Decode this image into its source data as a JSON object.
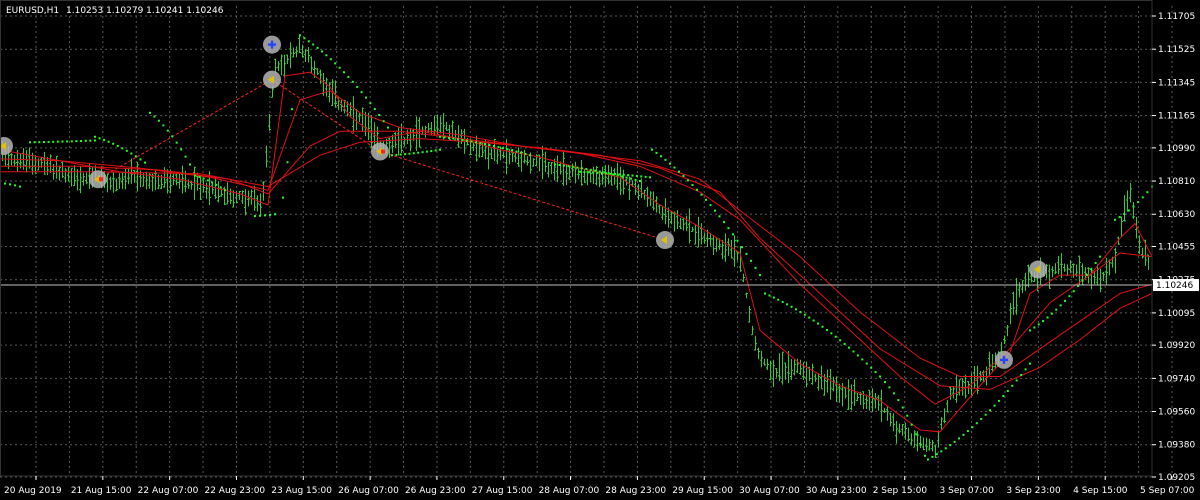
{
  "header": {
    "symbol_timeframe": "EURUSD,H1",
    "ohlc": "1.10253 1.10279 1.10241 1.10246"
  },
  "colors": {
    "background": "#000000",
    "grid": "#5a5a5a",
    "axis": "#ffffff",
    "bull_bar": "#33cc33",
    "ma": "#e01010",
    "psar": "#22ff22",
    "trade_line": "#ff2020",
    "signal_fill": "#b4b4b4",
    "signal_arrow": "#e0c000",
    "marker_blue": "#2244ff"
  },
  "chart_data": {
    "type": "bar",
    "title": "",
    "price_axis": {
      "labels": [
        "1.11705",
        "1.11525",
        "1.11345",
        "1.11165",
        "1.10990",
        "1.10810",
        "1.10630",
        "1.10455",
        "1.10275",
        "1.10095",
        "1.09920",
        "1.09740",
        "1.09560",
        "1.09380",
        "1.09205"
      ],
      "ylim": [
        1.09205,
        1.11705
      ]
    },
    "time_axis": {
      "labels": [
        "20 Aug 2019",
        "21 Aug 15:00",
        "22 Aug 07:00",
        "22 Aug 23:00",
        "23 Aug 15:00",
        "26 Aug 07:00",
        "26 Aug 23:00",
        "27 Aug 15:00",
        "28 Aug 07:00",
        "28 Aug 23:00",
        "29 Aug 15:00",
        "30 Aug 07:00",
        "30 Aug 23:00",
        "2 Sep 15:00",
        "3 Sep 07:00",
        "3 Sep 23:00",
        "4 Sep 15:00",
        "5 Sep 07:00"
      ]
    },
    "current_price": {
      "label": "1.10246",
      "value": 1.10246
    },
    "grid": true,
    "series": [
      {
        "kind": "price_bars",
        "anchors": [
          [
            0,
            1.1099
          ],
          [
            15,
            1.1092
          ],
          [
            40,
            1.1091
          ],
          [
            60,
            1.1086
          ],
          [
            80,
            1.1081
          ],
          [
            95,
            1.1084
          ],
          [
            110,
            1.1079
          ],
          [
            130,
            1.1083
          ],
          [
            155,
            1.108
          ],
          [
            175,
            1.1082
          ],
          [
            205,
            1.1078
          ],
          [
            230,
            1.1073
          ],
          [
            250,
            1.1071
          ],
          [
            262,
            1.1068
          ],
          [
            268,
            1.111
          ],
          [
            275,
            1.1142
          ],
          [
            285,
            1.1145
          ],
          [
            300,
            1.1154
          ],
          [
            320,
            1.1138
          ],
          [
            338,
            1.1124
          ],
          [
            350,
            1.1118
          ],
          [
            365,
            1.1112
          ],
          [
            380,
            1.11
          ],
          [
            400,
            1.1102
          ],
          [
            420,
            1.1108
          ],
          [
            440,
            1.1112
          ],
          [
            460,
            1.1104
          ],
          [
            480,
            1.1098
          ],
          [
            500,
            1.1095
          ],
          [
            520,
            1.1094
          ],
          [
            545,
            1.1089
          ],
          [
            565,
            1.1086
          ],
          [
            590,
            1.1084
          ],
          [
            610,
            1.1083
          ],
          [
            630,
            1.108
          ],
          [
            648,
            1.1072
          ],
          [
            660,
            1.1065
          ],
          [
            680,
            1.1059
          ],
          [
            700,
            1.1052
          ],
          [
            720,
            1.1047
          ],
          [
            740,
            1.104
          ],
          [
            750,
            1.1005
          ],
          [
            760,
            1.0985
          ],
          [
            775,
            1.0978
          ],
          [
            795,
            1.0981
          ],
          [
            815,
            1.0975
          ],
          [
            840,
            1.0967
          ],
          [
            860,
            1.0964
          ],
          [
            880,
            1.096
          ],
          [
            895,
            1.0948
          ],
          [
            915,
            1.094
          ],
          [
            935,
            1.0936
          ],
          [
            950,
            1.0966
          ],
          [
            975,
            1.0972
          ],
          [
            1000,
            1.0985
          ],
          [
            1015,
            1.1018
          ],
          [
            1025,
            1.1028
          ],
          [
            1040,
            1.1031
          ],
          [
            1060,
            1.1034
          ],
          [
            1080,
            1.1033
          ],
          [
            1100,
            1.1027
          ],
          [
            1115,
            1.104
          ],
          [
            1125,
            1.1068
          ],
          [
            1130,
            1.1075
          ],
          [
            1140,
            1.1043
          ],
          [
            1152,
            1.1035
          ]
        ]
      },
      {
        "kind": "moving_average",
        "points": [
          [
            0,
            1.1093
          ],
          [
            60,
            1.1092
          ],
          [
            140,
            1.1088
          ],
          [
            210,
            1.1083
          ],
          [
            268,
            1.1076
          ],
          [
            300,
            1.1125
          ],
          [
            330,
            1.113
          ],
          [
            360,
            1.1118
          ],
          [
            400,
            1.111
          ],
          [
            460,
            1.1106
          ],
          [
            520,
            1.11
          ],
          [
            580,
            1.1096
          ],
          [
            640,
            1.1089
          ],
          [
            700,
            1.1075
          ],
          [
            740,
            1.106
          ],
          [
            800,
            1.1025
          ],
          [
            860,
            1.0995
          ],
          [
            900,
            1.0975
          ],
          [
            935,
            1.096
          ],
          [
            970,
            1.097
          ],
          [
            1010,
            1.099
          ],
          [
            1050,
            1.1015
          ],
          [
            1090,
            1.103
          ],
          [
            1120,
            1.1042
          ],
          [
            1152,
            1.104
          ]
        ]
      },
      {
        "kind": "moving_average",
        "points": [
          [
            0,
            1.1089
          ],
          [
            80,
            1.1089
          ],
          [
            160,
            1.1087
          ],
          [
            230,
            1.1082
          ],
          [
            268,
            1.1074
          ],
          [
            310,
            1.11
          ],
          [
            340,
            1.1108
          ],
          [
            400,
            1.1108
          ],
          [
            460,
            1.1104
          ],
          [
            520,
            1.11
          ],
          [
            580,
            1.1096
          ],
          [
            640,
            1.1092
          ],
          [
            700,
            1.1082
          ],
          [
            740,
            1.1065
          ],
          [
            800,
            1.104
          ],
          [
            860,
            1.101
          ],
          [
            920,
            1.0985
          ],
          [
            960,
            1.0975
          ],
          [
            1000,
            1.0975
          ],
          [
            1040,
            1.099
          ],
          [
            1080,
            1.1005
          ],
          [
            1120,
            1.102
          ],
          [
            1152,
            1.1025
          ]
        ]
      },
      {
        "kind": "moving_average",
        "points": [
          [
            0,
            1.1086
          ],
          [
            100,
            1.1086
          ],
          [
            200,
            1.1085
          ],
          [
            268,
            1.1078
          ],
          [
            320,
            1.1095
          ],
          [
            360,
            1.1102
          ],
          [
            420,
            1.1104
          ],
          [
            480,
            1.1102
          ],
          [
            540,
            1.1099
          ],
          [
            600,
            1.1095
          ],
          [
            660,
            1.1088
          ],
          [
            720,
            1.1075
          ],
          [
            760,
            1.105
          ],
          [
            820,
            1.102
          ],
          [
            880,
            1.099
          ],
          [
            940,
            1.097
          ],
          [
            990,
            1.0968
          ],
          [
            1040,
            1.098
          ],
          [
            1080,
            1.0995
          ],
          [
            1120,
            1.1012
          ],
          [
            1152,
            1.102
          ]
        ]
      },
      {
        "kind": "moving_average",
        "points": [
          [
            0,
            1.1098
          ],
          [
            60,
            1.1092
          ],
          [
            120,
            1.1086
          ],
          [
            180,
            1.1082
          ],
          [
            240,
            1.1074
          ],
          [
            268,
            1.1068
          ],
          [
            285,
            1.1138
          ],
          [
            310,
            1.114
          ],
          [
            330,
            1.1132
          ],
          [
            350,
            1.1116
          ],
          [
            380,
            1.1104
          ],
          [
            420,
            1.1108
          ],
          [
            460,
            1.1104
          ],
          [
            500,
            1.1098
          ],
          [
            540,
            1.1094
          ],
          [
            580,
            1.1088
          ],
          [
            620,
            1.1083
          ],
          [
            660,
            1.1068
          ],
          [
            700,
            1.1056
          ],
          [
            740,
            1.1042
          ],
          [
            760,
            1.1
          ],
          [
            800,
            1.0982
          ],
          [
            840,
            1.097
          ],
          [
            880,
            1.0962
          ],
          [
            920,
            1.0946
          ],
          [
            940,
            1.0945
          ],
          [
            980,
            1.097
          ],
          [
            1010,
            1.0988
          ],
          [
            1030,
            1.102
          ],
          [
            1060,
            1.103
          ],
          [
            1090,
            1.103
          ],
          [
            1120,
            1.105
          ],
          [
            1135,
            1.1058
          ],
          [
            1152,
            1.104
          ]
        ]
      },
      {
        "kind": "parabolic_sar",
        "segments": [
          {
            "start": [
              0,
              1.108
            ],
            "end": [
              20,
              1.1078
            ]
          },
          {
            "start": [
              30,
              1.1102
            ],
            "end": [
              95,
              1.1103
            ]
          },
          {
            "start": [
              95,
              1.1105
            ],
            "end": [
              145,
              1.1091
            ]
          },
          {
            "start": [
              150,
              1.1118
            ],
            "end": [
              190,
              1.109
            ]
          },
          {
            "start": [
              195,
              1.1084
            ],
            "end": [
              225,
              1.1076
            ]
          },
          {
            "start": [
              255,
              1.1062
            ],
            "end": [
              275,
              1.1063
            ]
          },
          {
            "start": [
              283,
              1.1072
            ],
            "end": [
              292,
              1.112
            ]
          },
          {
            "start": [
              300,
              1.116
            ],
            "end": [
              388,
              1.111
            ]
          },
          {
            "start": [
              392,
              1.1095
            ],
            "end": [
              440,
              1.1098
            ]
          },
          {
            "start": [
              440,
              1.1105
            ],
            "end": [
              530,
              1.1095
            ]
          },
          {
            "start": [
              555,
              1.109
            ],
            "end": [
              640,
              1.1081
            ]
          },
          {
            "start": [
              580,
              1.1086
            ],
            "end": [
              650,
              1.1083
            ]
          },
          {
            "start": [
              652,
              1.1098
            ],
            "end": [
              760,
              1.103
            ]
          },
          {
            "start": [
              765,
              1.102
            ],
            "end": [
              880,
              1.0975
            ]
          },
          {
            "start": [
              885,
              1.0972
            ],
            "end": [
              925,
              1.0932
            ]
          },
          {
            "start": [
              928,
              1.093
            ],
            "end": [
              1030,
              1.0982
            ]
          },
          {
            "start": [
              1030,
              1.1
            ],
            "end": [
              1100,
              1.104
            ]
          },
          {
            "start": [
              1115,
              1.106
            ],
            "end": [
              1152,
              1.1078
            ]
          }
        ]
      }
    ],
    "trades": [
      {
        "from": [
          98,
          1.1082
        ],
        "to": [
          272,
          1.1136
        ]
      },
      {
        "from": [
          272,
          1.1136
        ],
        "to": [
          380,
          1.1097
        ]
      },
      {
        "from": [
          380,
          1.1097
        ],
        "to": [
          665,
          1.1049
        ]
      }
    ],
    "signals": [
      {
        "at": [
          4,
          1.11
        ],
        "kind": "arrow-left"
      },
      {
        "at": [
          98,
          1.1082
        ],
        "kind": "arrow-left-red"
      },
      {
        "at": [
          272,
          1.1155
        ],
        "kind": "plus-blue"
      },
      {
        "at": [
          272,
          1.1136
        ],
        "kind": "arrow-left"
      },
      {
        "at": [
          380,
          1.1097
        ],
        "kind": "arrow-left-red"
      },
      {
        "at": [
          665,
          1.1049
        ],
        "kind": "arrow-left"
      },
      {
        "at": [
          1004,
          1.0984
        ],
        "kind": "plus-blue"
      },
      {
        "at": [
          1038,
          1.1033
        ],
        "kind": "arrow-left"
      }
    ]
  }
}
